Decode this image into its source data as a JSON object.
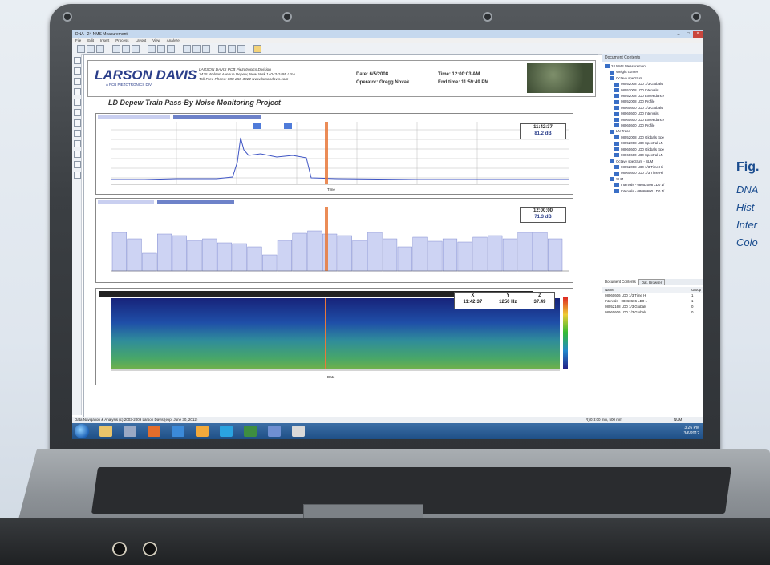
{
  "app": {
    "window_title": "DNA - 24 NMS Measurement",
    "menu": [
      "File",
      "Edit",
      "Insert",
      "Process",
      "Layout",
      "View",
      "Analyze"
    ]
  },
  "header": {
    "logo": "LARSON DAVIS",
    "logo_sub": "A PCB PIEZOTRONICS DIV.",
    "address_lines": [
      "LARSON DAVIS  PCB Piezotronics Division",
      "3425 Walden Avenue Depew,  New York 14043-2495  USA",
      "Toll-Free Phone: 888-258-3222  www.larsondavis.com"
    ],
    "date_label": "Date: 6/5/2008",
    "operator_label": "Operator: Gregg Novak",
    "time_label": "Time: 12:00:03 AM",
    "end_time_label": "End time: 11:59:49 PM"
  },
  "project_title": "LD Depew Train Pass-By Noise Monitoring Project",
  "panels": {
    "top": {
      "readout_time": "11:42:37",
      "readout_value": "81.2 dB",
      "axis_label": "Time"
    },
    "middle": {
      "readout_time": "12:00:00",
      "readout_value": "71.3 dB",
      "axis_label": "Date"
    },
    "bottom": {
      "x_label": "X",
      "y_label": "Y",
      "z_label": "Z",
      "x_value": "11:42:37",
      "y_value": "1250 Hz",
      "z_value": "37.49",
      "axis_label": "Date"
    }
  },
  "sidebar": {
    "title": "Document Contents",
    "tree": [
      "24 NMS Measurement",
      "Weight curves",
      "Octave spectrum",
      "08052008 LD0 1/3 Globals",
      "08052008 LD0 Intervals",
      "08052008 LD0 Exceedance",
      "08052008 LD0 Profile",
      "08060600 LD0 1/3 Globals",
      "08060600 LD0 Intervals",
      "08060600 LD0 Exceedance",
      "08060600 LD0 Profile",
      "LN Trace",
      "08052008 LD0 Globals Spe",
      "08052008 LD0 Spectral LN",
      "08060600 LD0 Globals Spe",
      "08060600 LD0 Spectral LN",
      "Octave spectrum - SLM",
      "08052008 LD0 1/3 Time Hi",
      "08060600 LD0 1/3 Time Hi",
      "SLM",
      "Intervals - 08052008 LD0 1/",
      "Intervals - 08060600 LD0 1/"
    ],
    "tabs": [
      "Document Contents",
      "Dat. Browser"
    ],
    "list_headers": [
      "Name",
      "Group"
    ],
    "list_rows": [
      [
        "08060606 LD0 1/3 Time Hi",
        "1"
      ],
      [
        "Intervals - 08060606 LD0 1",
        "1"
      ],
      [
        "08052168 LD0 1/3 Globals",
        "0"
      ],
      [
        "08060606 LD0 1/3 Globals",
        "0"
      ]
    ]
  },
  "status": {
    "left": "Data Navigation & Analysis (c) 2003-2009 Larson Davis (exp. June 30, 2012)",
    "right": "R) 0:8:00 min, 500 mm",
    "mode": "NUM",
    "clock_time": "3:26 PM",
    "clock_date": "3/6/2012"
  },
  "figure_caption": {
    "title": "Fig.",
    "lines": [
      "DNA",
      "Hist",
      "Inter",
      "Colo"
    ]
  },
  "colors": {
    "accent": "#2a3e8a",
    "cursor": "#e8783a",
    "bar": "#cdd3f3",
    "caption": "#1b4d8f"
  }
}
